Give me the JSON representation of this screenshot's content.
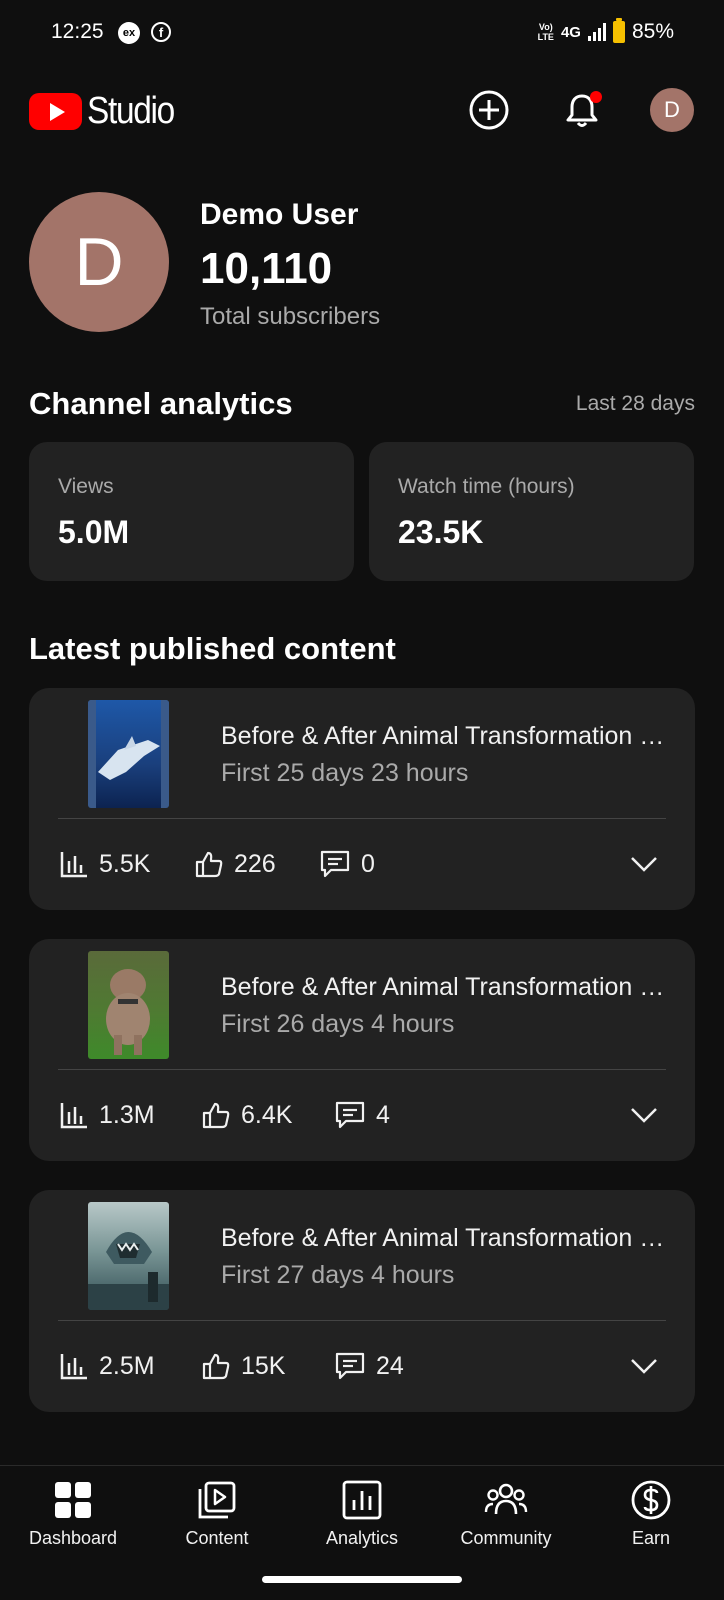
{
  "status_bar": {
    "time": "12:25",
    "ex_badge": "ex",
    "fb_badge": "f",
    "volte": "Vo)\nLTE",
    "network": "4G",
    "battery": "85%"
  },
  "header": {
    "logo_text": "Studio",
    "avatar_letter": "D"
  },
  "profile": {
    "avatar_letter": "D",
    "name": "Demo User",
    "subscribers": "10,110",
    "subscribers_label": "Total subscribers"
  },
  "analytics": {
    "title": "Channel analytics",
    "period": "Last 28 days",
    "cards": [
      {
        "label": "Views",
        "value": "5.0M"
      },
      {
        "label": "Watch time (hours)",
        "value": "23.5K"
      }
    ]
  },
  "latest": {
    "title": "Latest published content",
    "items": [
      {
        "title": "Before & After Animal Transformation Video",
        "subtitle": "First 25 days 23 hours",
        "views": "5.5K",
        "likes": "226",
        "comments": "0"
      },
      {
        "title": "Before & After Animal Transformation Video",
        "subtitle": "First 26 days 4 hours",
        "views": "1.3M",
        "likes": "6.4K",
        "comments": "4"
      },
      {
        "title": "Before & After Animal Transformation Video",
        "subtitle": "First 27 days 4 hours",
        "views": "2.5M",
        "likes": "15K",
        "comments": "24"
      }
    ]
  },
  "nav": [
    {
      "label": "Dashboard",
      "icon": "dashboard-icon"
    },
    {
      "label": "Content",
      "icon": "content-icon"
    },
    {
      "label": "Analytics",
      "icon": "analytics-icon"
    },
    {
      "label": "Community",
      "icon": "community-icon"
    },
    {
      "label": "Earn",
      "icon": "earn-icon"
    }
  ],
  "colors": {
    "background": "#0f0f0f",
    "card": "#222222",
    "brand_red": "#ff0000",
    "avatar": "#a37469",
    "secondary_text": "#aaaaaa"
  }
}
